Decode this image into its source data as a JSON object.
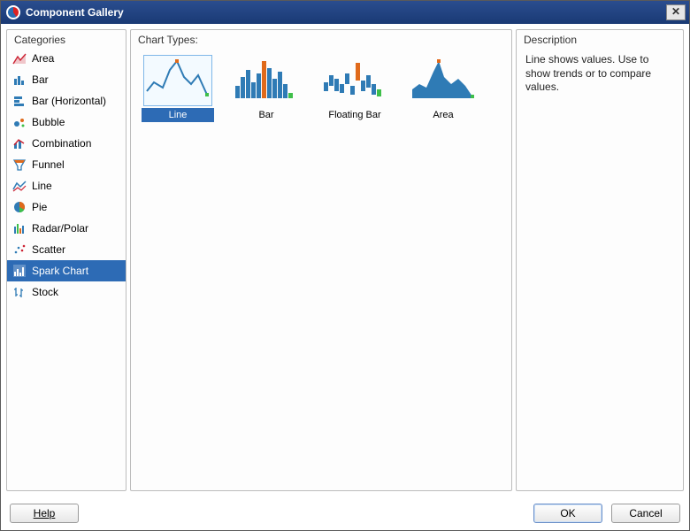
{
  "window": {
    "title": "Component Gallery"
  },
  "sidebar": {
    "header": "Categories",
    "items": [
      {
        "label": "Area",
        "icon": "area-chart-icon"
      },
      {
        "label": "Bar",
        "icon": "bar-chart-icon"
      },
      {
        "label": "Bar (Horizontal)",
        "icon": "bar-horizontal-chart-icon"
      },
      {
        "label": "Bubble",
        "icon": "bubble-chart-icon"
      },
      {
        "label": "Combination",
        "icon": "combination-chart-icon"
      },
      {
        "label": "Funnel",
        "icon": "funnel-chart-icon"
      },
      {
        "label": "Line",
        "icon": "line-chart-icon"
      },
      {
        "label": "Pie",
        "icon": "pie-chart-icon"
      },
      {
        "label": "Radar/Polar",
        "icon": "radar-chart-icon"
      },
      {
        "label": "Scatter",
        "icon": "scatter-chart-icon"
      },
      {
        "label": "Spark Chart",
        "icon": "spark-chart-icon",
        "selected": true
      },
      {
        "label": "Stock",
        "icon": "stock-chart-icon"
      }
    ]
  },
  "main": {
    "header": "Chart Types:",
    "types": [
      {
        "label": "Line",
        "selected": true
      },
      {
        "label": "Bar"
      },
      {
        "label": "Floating Bar"
      },
      {
        "label": "Area"
      }
    ]
  },
  "description": {
    "header": "Description",
    "body": "Line shows values. Use to show trends or to compare values."
  },
  "footer": {
    "help_label": "Help",
    "ok_label": "OK",
    "cancel_label": "Cancel"
  },
  "colors": {
    "accent": "#2d6bb5",
    "spark_blue": "#2f7bb5",
    "spark_orange": "#e06a1b",
    "spark_green": "#3fbf4a"
  }
}
